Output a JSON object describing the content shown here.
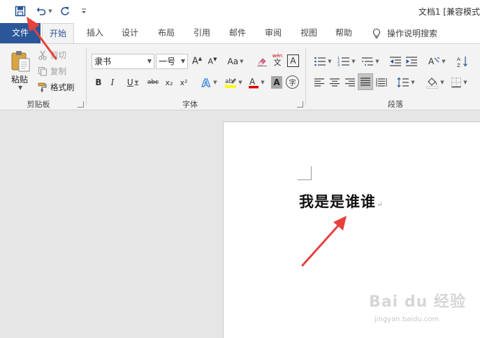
{
  "titlebar": {
    "doc_title": "文档1 [兼容模式"
  },
  "tabs": [
    {
      "id": "file",
      "label": "文件"
    },
    {
      "id": "home",
      "label": "开始"
    },
    {
      "id": "insert",
      "label": "插入"
    },
    {
      "id": "design",
      "label": "设计"
    },
    {
      "id": "layout",
      "label": "布局"
    },
    {
      "id": "references",
      "label": "引用"
    },
    {
      "id": "mailings",
      "label": "邮件"
    },
    {
      "id": "review",
      "label": "审阅"
    },
    {
      "id": "view",
      "label": "视图"
    },
    {
      "id": "help",
      "label": "帮助"
    }
  ],
  "tell_me": "操作说明搜索",
  "clipboard": {
    "paste": "粘贴",
    "cut": "剪切",
    "copy": "复制",
    "format_painter": "格式刷",
    "group_label": "剪贴板"
  },
  "font": {
    "font_name": "隶书",
    "font_size": "一号",
    "group_label": "字体",
    "change_case": "Aa",
    "phonetic": "wén",
    "phonetic_char": "文",
    "border_char": "A",
    "bold": "B",
    "italic": "I",
    "underline": "U",
    "strike": "abc",
    "subscript": "x₂",
    "superscript": "x²",
    "char_shading": "A",
    "enclose": "字"
  },
  "paragraph": {
    "group_label": "段落"
  },
  "document": {
    "text": "我是是谁谁",
    "para_mark": "↵"
  },
  "watermark": {
    "brand": "Bai du 经验",
    "url": "jingyan.baidu.com"
  },
  "colors": {
    "accent": "#2b579a",
    "arrow": "#e8413c",
    "highlight": "#ffff00",
    "font_color": "#e00000"
  }
}
